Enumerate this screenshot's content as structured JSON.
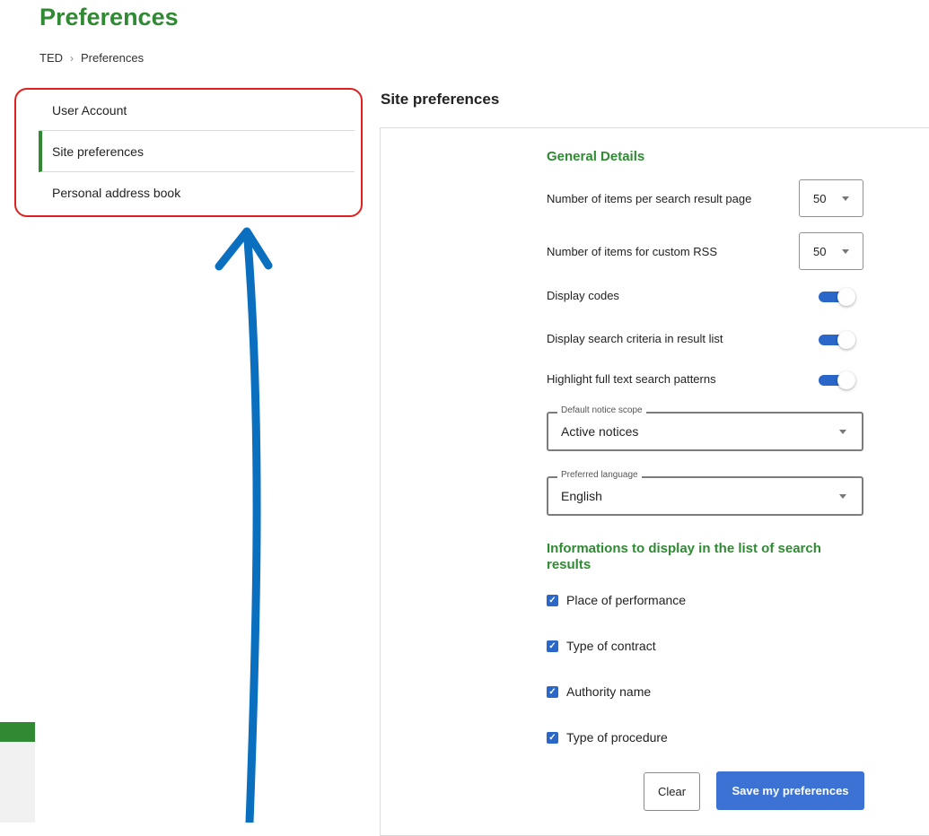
{
  "page": {
    "title": "Preferences",
    "breadcrumb": [
      "TED",
      "Preferences"
    ],
    "breadcrumb_separator": "›"
  },
  "sidebar": {
    "items": [
      {
        "label": "User Account"
      },
      {
        "label": "Site preferences",
        "active": true
      },
      {
        "label": "Personal address book"
      }
    ]
  },
  "main": {
    "section_title": "Site preferences",
    "general": {
      "heading": "General Details",
      "items_per_page": {
        "label": "Number of items per search result page",
        "value": "50"
      },
      "items_rss": {
        "label": "Number of items for custom RSS",
        "value": "50"
      },
      "display_codes": {
        "label": "Display codes",
        "on": true
      },
      "display_criteria": {
        "label": "Display search criteria in result list",
        "on": true
      },
      "highlight_patterns": {
        "label": "Highlight full text search patterns",
        "on": true
      },
      "notice_scope": {
        "legend": "Default notice scope",
        "value": "Active notices"
      },
      "language": {
        "legend": "Preferred language",
        "value": "English"
      }
    },
    "info": {
      "heading": "Informations to display in the list of search results",
      "checkboxes": [
        {
          "label": "Place of performance",
          "checked": true
        },
        {
          "label": "Type of contract",
          "checked": true
        },
        {
          "label": "Authority name",
          "checked": true
        },
        {
          "label": "Type of procedure",
          "checked": true
        }
      ]
    },
    "buttons": {
      "clear": "Clear",
      "save": "Save my preferences"
    }
  },
  "colors": {
    "brand_green": "#2f8a33",
    "accent_blue": "#3b72d4",
    "annotation_red": "#e02020",
    "annotation_arrow": "#0a6fbf"
  }
}
